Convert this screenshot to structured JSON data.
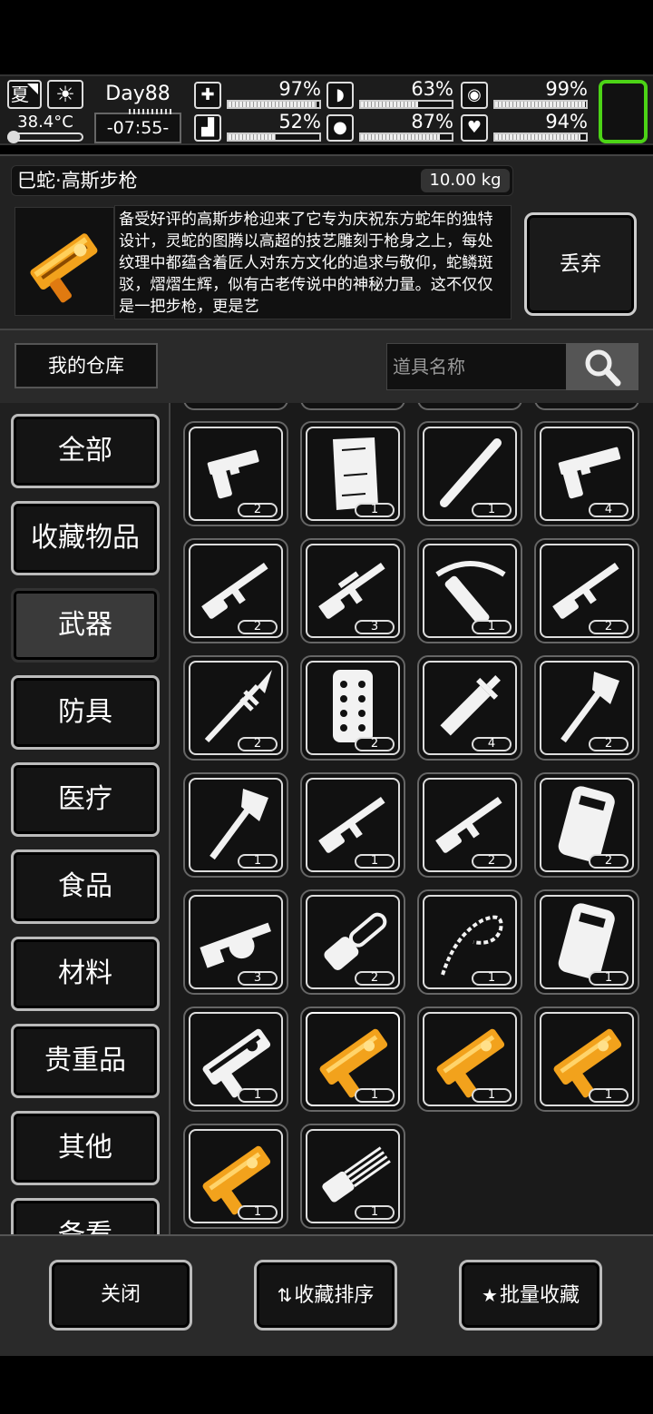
{
  "status": {
    "season": "夏",
    "temperature": "38.4°C",
    "day": "Day88",
    "time": "-07:55-",
    "stats": [
      {
        "id": "health",
        "icon": "first-aid-icon",
        "glyph": "✚",
        "pct": "97%",
        "fill": 0.97
      },
      {
        "id": "hunger",
        "icon": "stomach-icon",
        "glyph": "◗",
        "pct": "63%",
        "fill": 0.63
      },
      {
        "id": "mood",
        "icon": "helmet-icon",
        "glyph": "◉",
        "pct": "99%",
        "fill": 0.99
      },
      {
        "id": "stamina",
        "icon": "boot-icon",
        "glyph": "▟",
        "pct": "52%",
        "fill": 0.52
      },
      {
        "id": "thirst",
        "icon": "water-drop-icon",
        "glyph": "●",
        "pct": "87%",
        "fill": 0.87
      },
      {
        "id": "heart",
        "icon": "heart-icon",
        "glyph": "♥",
        "pct": "94%",
        "fill": 0.94
      }
    ]
  },
  "detail": {
    "name": "巳蛇·高斯步枪",
    "weight": "10.00 kg",
    "description": "备受好评的高斯步枪迎来了它专为庆祝东方蛇年的独特设计，灵蛇的图腾以高超的技艺雕刻于枪身之上，每处纹理中都蕴含着匠人对东方文化的追求与敬仰，蛇鳞斑驳，熠熠生辉，似有古老传说中的神秘力量。这不仅仅是一把步枪，更是艺",
    "discard": "丢弃"
  },
  "warehouse": {
    "title": "我的仓库",
    "search_placeholder": "道具名称"
  },
  "categories": [
    "全部",
    "收藏物品",
    "武器",
    "防具",
    "医疗",
    "食品",
    "材料",
    "贵重品",
    "其他",
    "备看"
  ],
  "active_category": "武器",
  "items": [
    {
      "icon": "desert-eagle-pistol-icon",
      "qty": "2"
    },
    {
      "icon": "wooden-plank-icon",
      "qty": "1"
    },
    {
      "icon": "baseball-bat-icon",
      "qty": "1"
    },
    {
      "icon": "silenced-pistol-icon",
      "qty": "4"
    },
    {
      "icon": "hunting-rifle-icon",
      "qty": "2"
    },
    {
      "icon": "sniper-rifle-icon",
      "qty": "3"
    },
    {
      "icon": "crossbow-icon",
      "qty": "1"
    },
    {
      "icon": "assault-rifle-icon",
      "qty": "2"
    },
    {
      "icon": "spear-icon",
      "qty": "2"
    },
    {
      "icon": "spiked-shield-icon",
      "qty": "2"
    },
    {
      "icon": "sword-icon",
      "qty": "4"
    },
    {
      "icon": "tomahawk-icon",
      "qty": "2"
    },
    {
      "icon": "axe-icon",
      "qty": "1"
    },
    {
      "icon": "m16-rifle-icon",
      "qty": "1"
    },
    {
      "icon": "shotgun-icon",
      "qty": "2"
    },
    {
      "icon": "riot-shield-icon",
      "qty": "2"
    },
    {
      "icon": "grenade-launcher-icon",
      "qty": "3"
    },
    {
      "icon": "chainsaw-icon",
      "qty": "2"
    },
    {
      "icon": "chain-whip-icon",
      "qty": "1"
    },
    {
      "icon": "armored-shield-icon",
      "qty": "1"
    },
    {
      "icon": "dragon-rifle-icon",
      "qty": "1"
    },
    {
      "icon": "snake-gauss-rifle-icon",
      "qty": "1",
      "gold": true,
      "selected": true
    },
    {
      "icon": "golden-dragon-staff-icon",
      "qty": "1",
      "gold": true
    },
    {
      "icon": "golden-gauss-rifle-icon",
      "qty": "1",
      "gold": true
    },
    {
      "icon": "golden-blaster-icon",
      "qty": "1",
      "gold": true
    },
    {
      "icon": "minigun-icon",
      "qty": "1"
    }
  ],
  "footer": {
    "close": "关闭",
    "sort": "收藏排序",
    "batch": "批量收藏"
  },
  "colors": {
    "accent_green": "#4cd316",
    "gold": "#f2a21c"
  }
}
